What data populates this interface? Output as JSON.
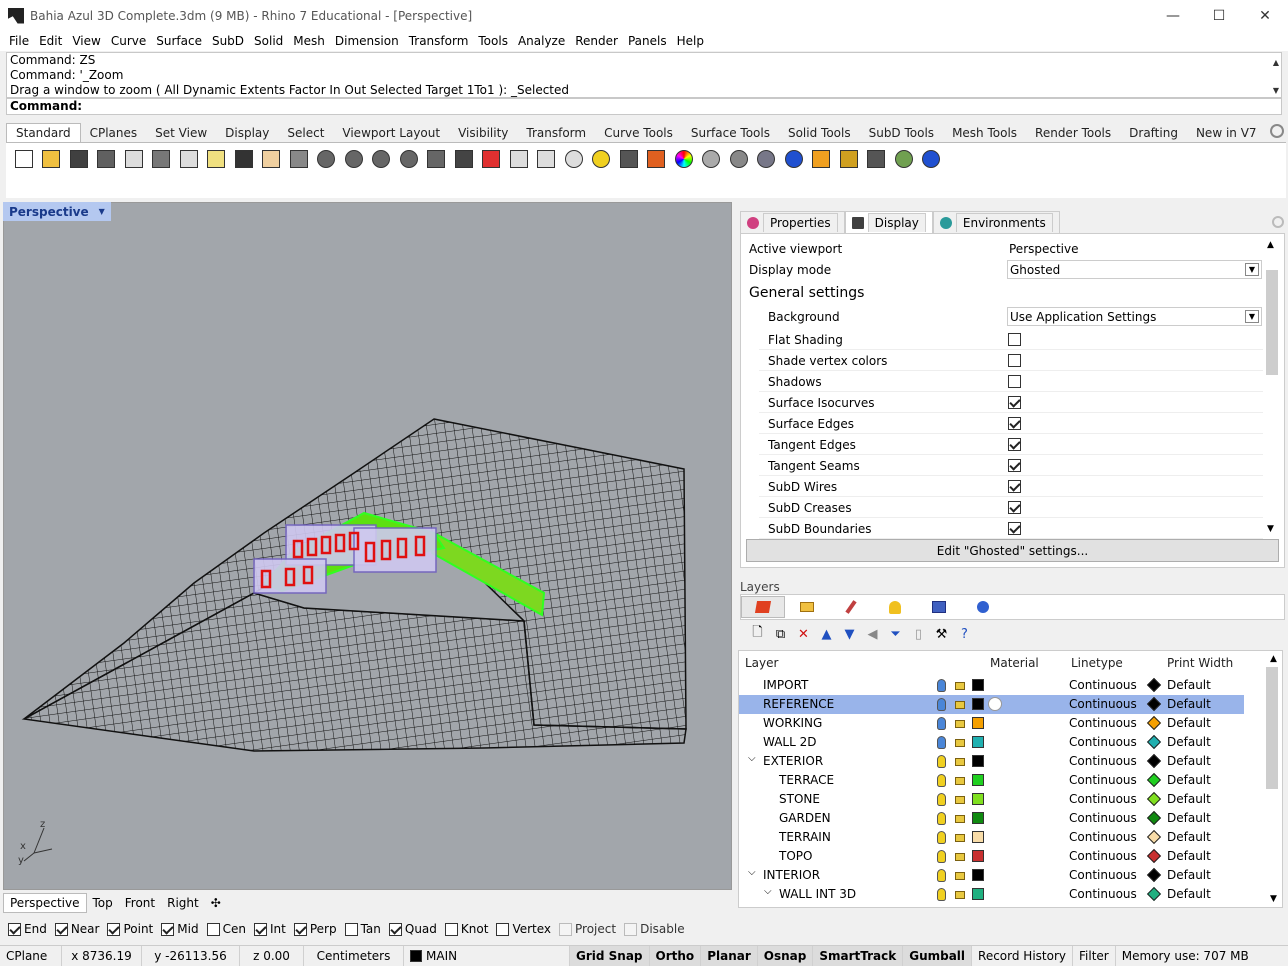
{
  "window": {
    "title": "Bahia Azul 3D Complete.3dm (9 MB) - Rhino 7 Educational - [Perspective]",
    "minimize": "—",
    "maximize": "☐",
    "close": "✕"
  },
  "menu": [
    "File",
    "Edit",
    "View",
    "Curve",
    "Surface",
    "SubD",
    "Solid",
    "Mesh",
    "Dimension",
    "Transform",
    "Tools",
    "Analyze",
    "Render",
    "Panels",
    "Help"
  ],
  "command_history": [
    "Command: ZS",
    "Command: '_Zoom",
    "Drag a window to zoom ( All  Dynamic  Extents  Factor  In  Out  Selected  Target  1To1 ): _Selected"
  ],
  "command_prompt": "Command:",
  "toolbar_tabs": [
    "Standard",
    "CPlanes",
    "Set View",
    "Display",
    "Select",
    "Viewport Layout",
    "Visibility",
    "Transform",
    "Curve Tools",
    "Surface Tools",
    "Solid Tools",
    "SubD Tools",
    "Mesh Tools",
    "Render Tools",
    "Drafting",
    "New in V7"
  ],
  "toolbar_icons": [
    "new-icon",
    "open-icon",
    "save-icon",
    "print-icon",
    "import-icon",
    "cut-icon",
    "copy-icon",
    "paste-icon",
    "undo-icon",
    "pan-hand-icon",
    "move-view-icon",
    "zoom-icon",
    "zoom-window-icon",
    "zoom-extents-icon",
    "zoom-selected-icon",
    "rotate-view-icon",
    "four-viewports-icon",
    "car-icon",
    "snapshot-icon",
    "cplane-icon",
    "point-icon",
    "light-icon",
    "lock-icon",
    "layer-icon",
    "color-wheel-icon",
    "render-sphere-icon",
    "shaded-sphere-icon",
    "glass-sphere-icon",
    "blue-sphere-icon",
    "flag-icon",
    "gear-multi-icon",
    "grip-icon",
    "zebra-icon",
    "help-icon"
  ],
  "viewport": {
    "title": "Perspective",
    "tabs": [
      "Perspective",
      "Top",
      "Front",
      "Right"
    ],
    "add_tab": "✣",
    "axis": {
      "x": "x",
      "y": "y",
      "z": "z"
    }
  },
  "osnaps": [
    {
      "label": "End",
      "checked": true
    },
    {
      "label": "Near",
      "checked": true
    },
    {
      "label": "Point",
      "checked": true
    },
    {
      "label": "Mid",
      "checked": true
    },
    {
      "label": "Cen",
      "checked": false
    },
    {
      "label": "Int",
      "checked": true
    },
    {
      "label": "Perp",
      "checked": true
    },
    {
      "label": "Tan",
      "checked": false
    },
    {
      "label": "Quad",
      "checked": true
    },
    {
      "label": "Knot",
      "checked": false
    },
    {
      "label": "Vertex",
      "checked": false
    },
    {
      "label": "Project",
      "checked": false,
      "disabled": true
    },
    {
      "label": "Disable",
      "checked": false,
      "disabled": true
    }
  ],
  "status": {
    "cplane": "CPlane",
    "x": "x 8736.19",
    "y": "y -26113.56",
    "z": "z 0.00",
    "units": "Centimeters",
    "layer": "MAIN",
    "toggles": [
      "Grid Snap",
      "Ortho",
      "Planar",
      "Osnap",
      "SmartTrack",
      "Gumball"
    ],
    "record": "Record History",
    "filter": "Filter",
    "memory": "Memory use: 707 MB"
  },
  "panel_tabs": [
    {
      "label": "Properties",
      "color": "#d04080"
    },
    {
      "label": "Display",
      "color": "#404040"
    },
    {
      "label": "Environments",
      "color": "#2a9a9a"
    }
  ],
  "display": {
    "active_viewport_label": "Active viewport",
    "active_viewport": "Perspective",
    "display_mode_label": "Display mode",
    "display_mode": "Ghosted",
    "general_settings": "General settings",
    "background_label": "Background",
    "background": "Use Application Settings",
    "options": [
      {
        "label": "Flat Shading",
        "checked": false
      },
      {
        "label": "Shade vertex colors",
        "checked": false
      },
      {
        "label": "Shadows",
        "checked": false
      },
      {
        "label": "Surface Isocurves",
        "checked": true
      },
      {
        "label": "Surface Edges",
        "checked": true
      },
      {
        "label": "Tangent Edges",
        "checked": true
      },
      {
        "label": "Tangent Seams",
        "checked": true
      },
      {
        "label": "SubD Wires",
        "checked": true
      },
      {
        "label": "SubD Creases",
        "checked": true
      },
      {
        "label": "SubD Boundaries",
        "checked": true
      }
    ],
    "edit_button": "Edit \"Ghosted\" settings..."
  },
  "layers_panel": {
    "title": "Layers",
    "columns": {
      "layer": "Layer",
      "material": "Material",
      "linetype": "Linetype",
      "print_width": "Print Width"
    },
    "rows": [
      {
        "name": "IMPORT",
        "indent": 0,
        "color": "#000000",
        "linetype": "Continuous",
        "print_width": "Default",
        "diamond": "#000000",
        "bulb": "#4a86d8"
      },
      {
        "name": "REFERENCE",
        "indent": 0,
        "color": "#000000",
        "linetype": "Continuous",
        "print_width": "Default",
        "diamond": "#000000",
        "bulb": "#4a86d8",
        "selected": true
      },
      {
        "name": "WORKING",
        "indent": 0,
        "color": "#f5a000",
        "linetype": "Continuous",
        "print_width": "Default",
        "diamond": "#f5a000",
        "bulb": "#4a86d8"
      },
      {
        "name": "WALL 2D",
        "indent": 0,
        "color": "#20b0b0",
        "linetype": "Continuous",
        "print_width": "Default",
        "diamond": "#20b0b0",
        "bulb": "#4a86d8"
      },
      {
        "name": "EXTERIOR",
        "indent": 0,
        "expand": "⌵",
        "color": "#000000",
        "linetype": "Continuous",
        "print_width": "Default",
        "diamond": "#000000",
        "bulb": "#f0d020"
      },
      {
        "name": "TERRACE",
        "indent": 1,
        "color": "#20d020",
        "linetype": "Continuous",
        "print_width": "Default",
        "diamond": "#20d020",
        "bulb": "#f0d020"
      },
      {
        "name": "STONE",
        "indent": 1,
        "color": "#80e020",
        "linetype": "Continuous",
        "print_width": "Default",
        "diamond": "#80e020",
        "bulb": "#f0d020"
      },
      {
        "name": "GARDEN",
        "indent": 1,
        "color": "#108a10",
        "linetype": "Continuous",
        "print_width": "Default",
        "diamond": "#108a10",
        "bulb": "#f0d020"
      },
      {
        "name": "TERRAIN",
        "indent": 1,
        "color": "#f8dca8",
        "linetype": "Continuous",
        "print_width": "Default",
        "diamond": "#f8dca8",
        "bulb": "#f0d020"
      },
      {
        "name": "TOPO",
        "indent": 1,
        "color": "#c83030",
        "linetype": "Continuous",
        "print_width": "Default",
        "diamond": "#c83030",
        "bulb": "#f0d020"
      },
      {
        "name": "INTERIOR",
        "indent": 0,
        "expand": "⌵",
        "color": "#000000",
        "linetype": "Continuous",
        "print_width": "Default",
        "diamond": "#000000",
        "bulb": "#f0d020"
      },
      {
        "name": "WALL INT 3D",
        "indent": 1,
        "expand": "⌵",
        "color": "#20b080",
        "linetype": "Continuous",
        "print_width": "Default",
        "diamond": "#20b080",
        "bulb": "#f0d020"
      }
    ]
  }
}
